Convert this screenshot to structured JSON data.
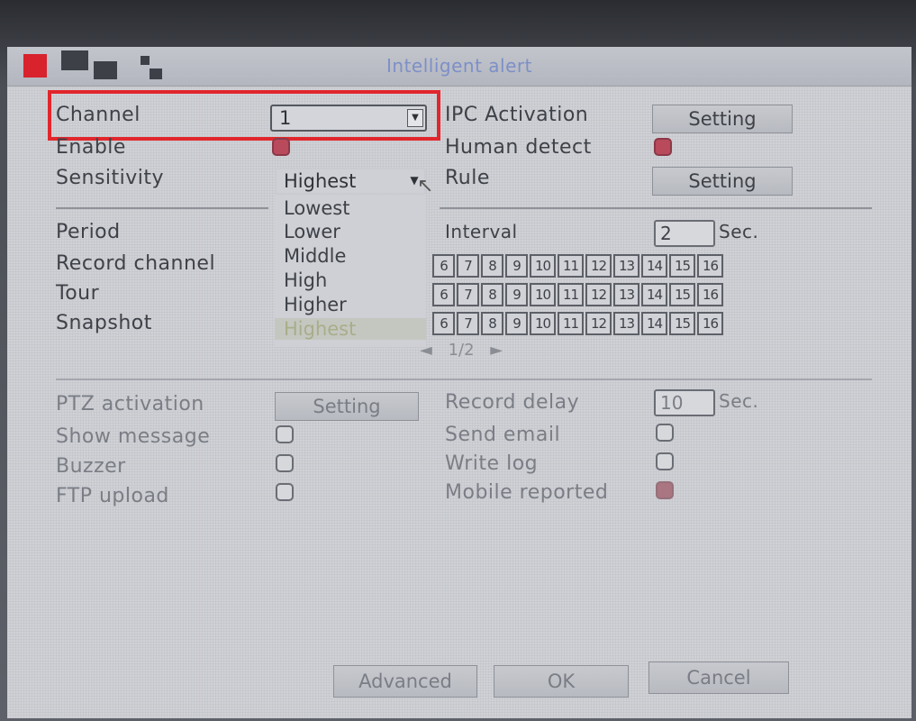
{
  "window": {
    "title": "Intelligent alert"
  },
  "channel": {
    "label": "Channel",
    "value": "1"
  },
  "enable": {
    "label": "Enable",
    "checked": true
  },
  "sensitivity": {
    "label": "Sensitivity",
    "value": "Highest",
    "options": [
      "Lowest",
      "Lower",
      "Middle",
      "High",
      "Higher",
      "Highest"
    ],
    "selected": "Highest"
  },
  "ipc_activation": {
    "label": "IPC Activation",
    "button": "Setting"
  },
  "human_detect": {
    "label": "Human detect",
    "checked": true
  },
  "rule": {
    "label": "Rule",
    "button": "Setting"
  },
  "period": {
    "label": "Period"
  },
  "interval": {
    "label": "Interval",
    "value": "2",
    "unit": "Sec."
  },
  "record_channel": {
    "label": "Record channel"
  },
  "tour": {
    "label": "Tour"
  },
  "snapshot": {
    "label": "Snapshot"
  },
  "channel_numbers": [
    "6",
    "7",
    "8",
    "9",
    "10",
    "11",
    "12",
    "13",
    "14",
    "15",
    "16"
  ],
  "pager": {
    "prev": "◄",
    "text": "1/2",
    "next": "►"
  },
  "ptz_activation": {
    "label": "PTZ activation",
    "button": "Setting"
  },
  "record_delay": {
    "label": "Record delay",
    "value": "10",
    "unit": "Sec."
  },
  "show_message": {
    "label": "Show message",
    "checked": false
  },
  "send_email": {
    "label": "Send email",
    "checked": false
  },
  "buzzer": {
    "label": "Buzzer",
    "checked": false
  },
  "write_log": {
    "label": "Write log",
    "checked": false
  },
  "ftp_upload": {
    "label": "FTP upload",
    "checked": false
  },
  "mobile_reported": {
    "label": "Mobile reported",
    "checked": true
  },
  "footer": {
    "advanced": "Advanced",
    "ok": "OK",
    "cancel": "Cancel"
  },
  "colors": {
    "highlight": "#e1262c",
    "checked": "#b84a5c",
    "title": "#7d8fc8"
  }
}
